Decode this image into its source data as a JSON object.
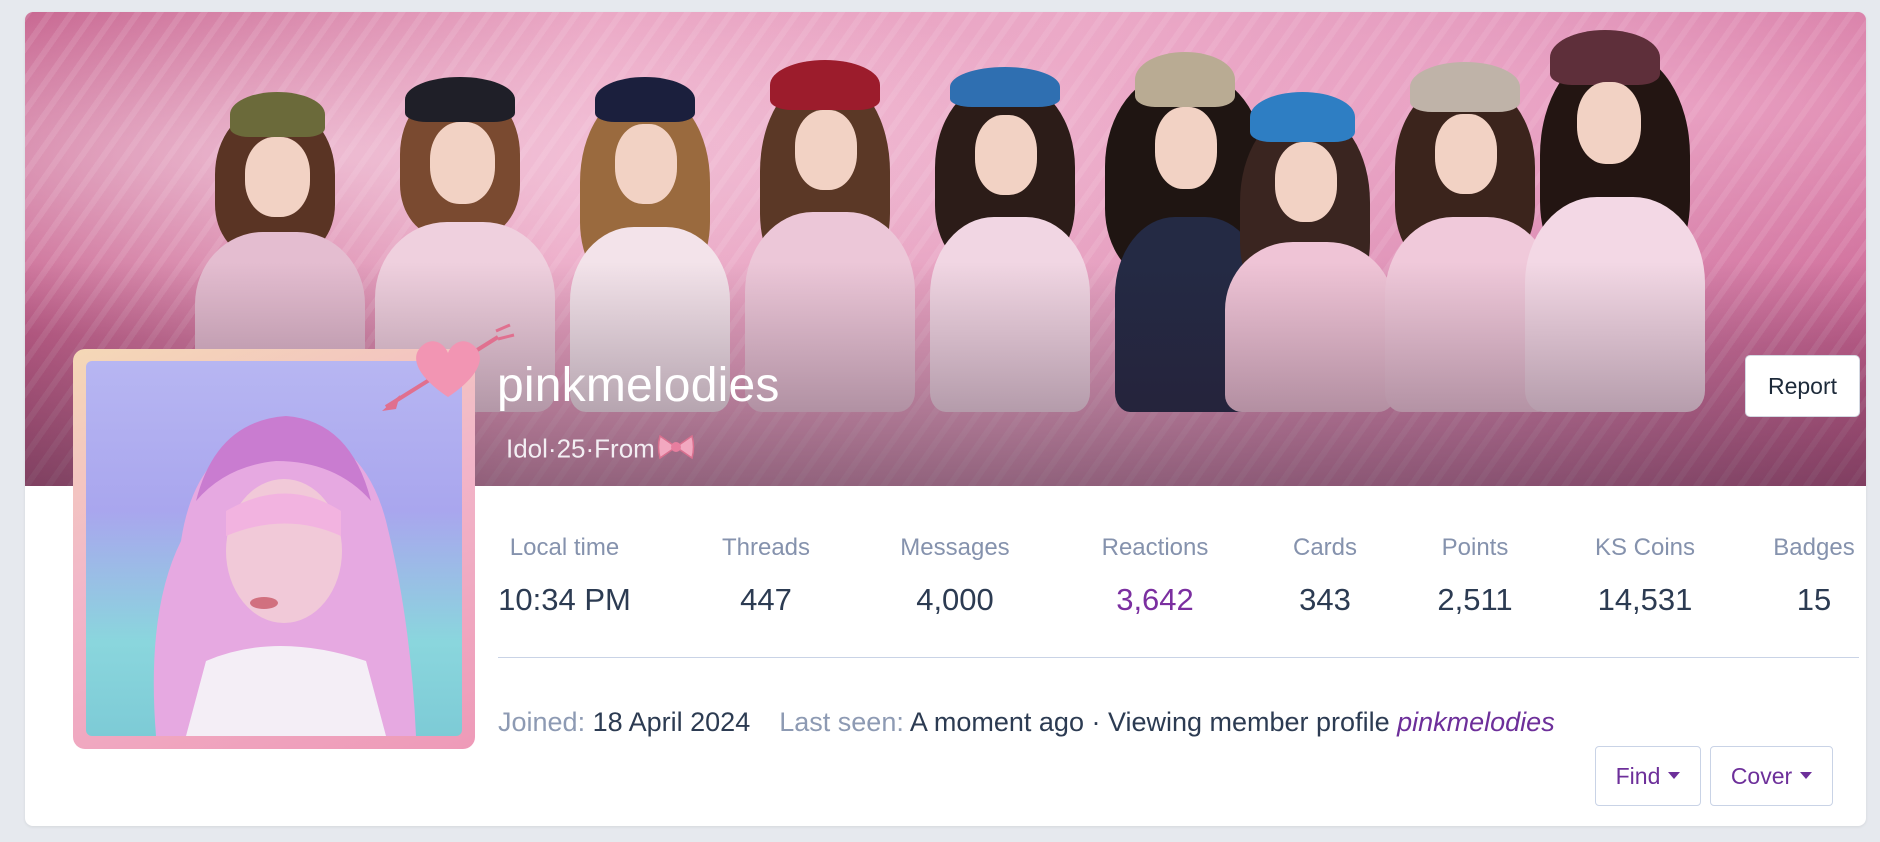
{
  "profile": {
    "username": "pinkmelodies",
    "tagline": "Idol·25·From"
  },
  "actions": {
    "report_label": "Report",
    "find_label": "Find",
    "cover_label": "Cover"
  },
  "stats": {
    "local_time_label": "Local time",
    "local_time_value": "10:34 PM",
    "threads_label": "Threads",
    "threads_value": "447",
    "messages_label": "Messages",
    "messages_value": "4,000",
    "reactions_label": "Reactions",
    "reactions_value": "3,642",
    "cards_label": "Cards",
    "cards_value": "343",
    "points_label": "Points",
    "points_value": "2,511",
    "coins_label": "KS Coins",
    "coins_value": "14,531",
    "badges_label": "Badges",
    "badges_value": "15"
  },
  "meta": {
    "joined_label": "Joined:",
    "joined_value": "18 April 2024",
    "last_seen_label": "Last seen:",
    "last_seen_value": "A moment ago · Viewing member profile",
    "last_seen_link": "pinkmelodies"
  },
  "colors": {
    "accent": "#7b2fa0",
    "cover_pink": "#e7a3c2",
    "frame_pink": "#ee9ab8"
  },
  "icons": {
    "tagline_emoji": "ribbon-bow-icon",
    "avatar_decoration": "heart-arrow-icon",
    "dropdown": "caret-down-icon"
  }
}
